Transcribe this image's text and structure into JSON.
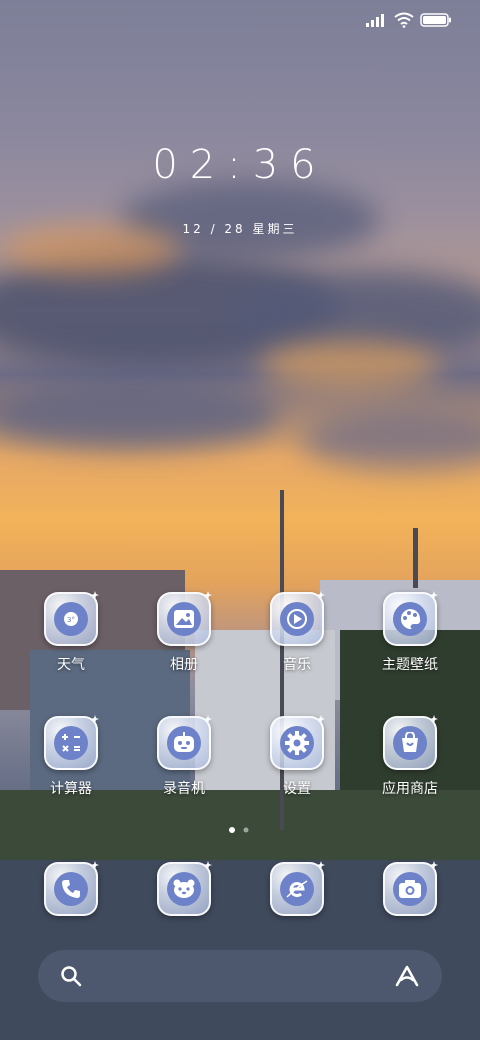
{
  "status_bar": {
    "signal_icon": "signal-icon",
    "wifi_icon": "wifi-icon",
    "battery_icon": "battery-icon"
  },
  "lock": {
    "time": "02:36",
    "date": "12 / 28  星期三"
  },
  "apps": [
    {
      "label": "天气",
      "icon": "weather-icon"
    },
    {
      "label": "相册",
      "icon": "gallery-icon"
    },
    {
      "label": "音乐",
      "icon": "music-icon"
    },
    {
      "label": "主题壁纸",
      "icon": "theme-icon"
    },
    {
      "label": "计算器",
      "icon": "calculator-icon"
    },
    {
      "label": "录音机",
      "icon": "recorder-icon"
    },
    {
      "label": "设置",
      "icon": "settings-icon"
    },
    {
      "label": "应用商店",
      "icon": "app-store-icon"
    }
  ],
  "dock": [
    {
      "icon": "phone-icon"
    },
    {
      "icon": "contacts-icon"
    },
    {
      "icon": "browser-icon"
    },
    {
      "icon": "camera-icon"
    }
  ],
  "search_bar": {
    "search_icon": "search-icon",
    "assistant_icon": "assistant-icon"
  },
  "colors": {
    "tile_inner": "#6d82c8"
  }
}
